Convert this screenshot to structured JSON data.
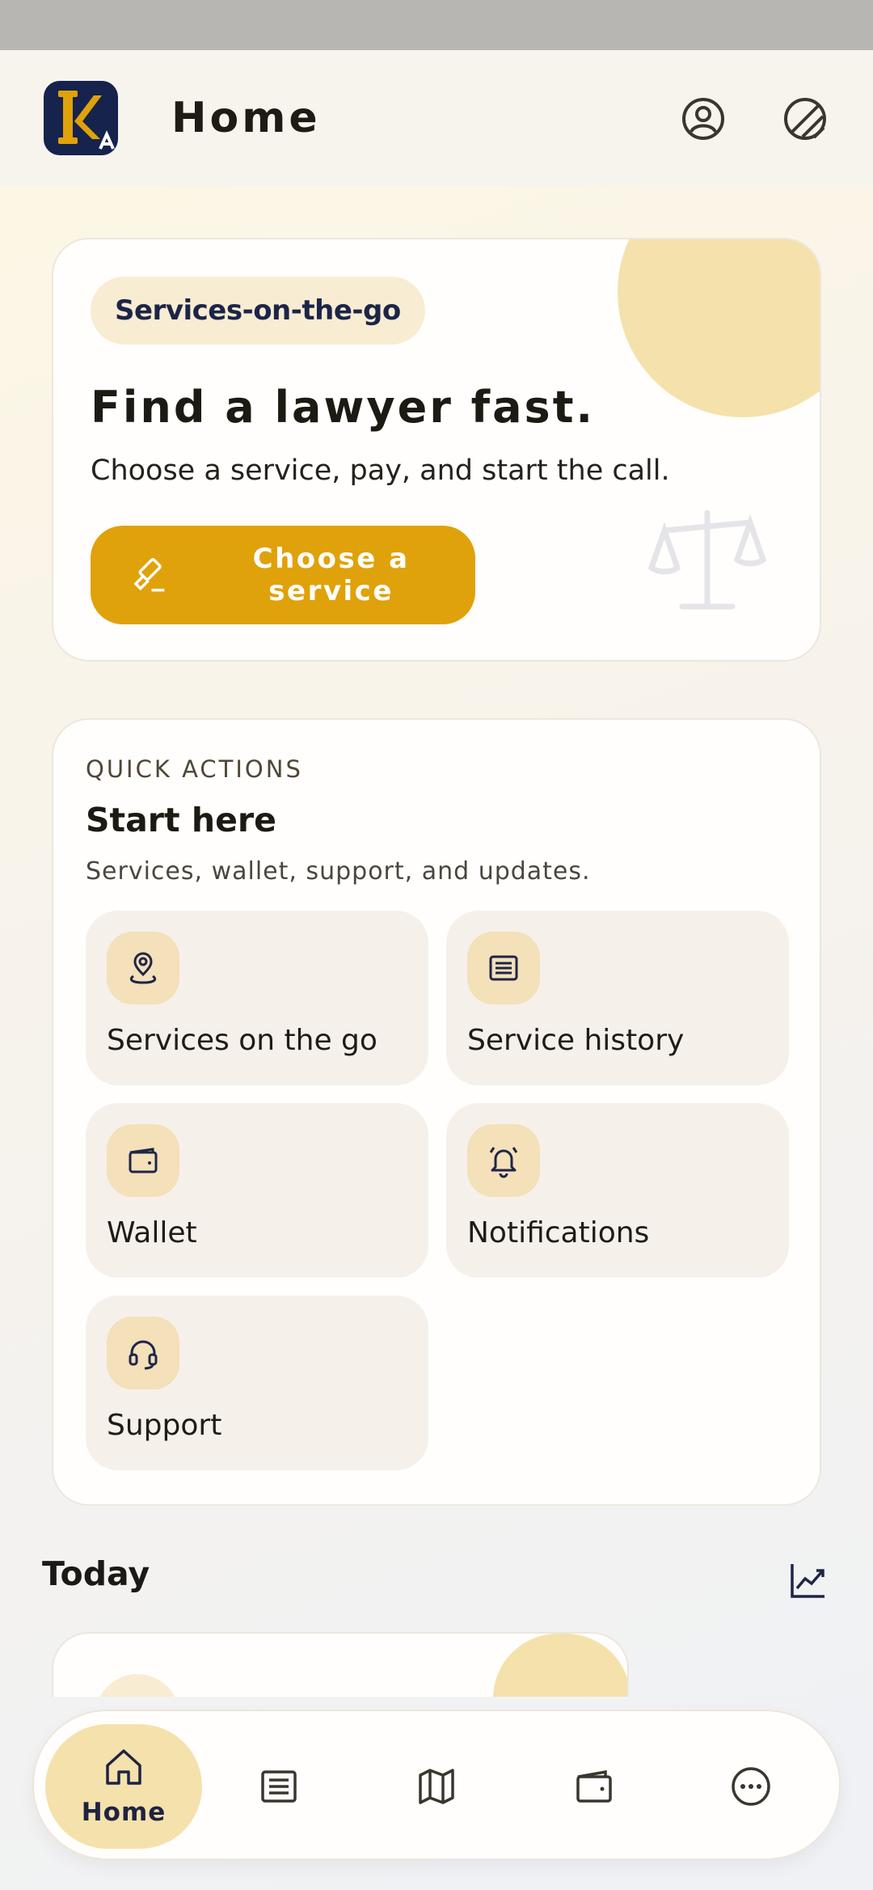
{
  "header": {
    "logo_letters": "KA",
    "title": "Home",
    "icons": [
      "profile-icon",
      "theme-toggle-icon"
    ]
  },
  "hero": {
    "chip": "Services-on-the-go",
    "title": "Find a lawyer fast.",
    "subtitle": "Choose a service, pay, and start the call.",
    "cta_label": "Choose a service",
    "cta_icon": "gavel-icon",
    "decor_icon": "scale-icon"
  },
  "quick_actions": {
    "eyebrow": "QUICK ACTIONS",
    "title": "Start here",
    "subtitle": "Services, wallet, support, and updates.",
    "tiles": [
      {
        "label": "Services on the go",
        "icon": "map-pin-icon"
      },
      {
        "label": "Service history",
        "icon": "document-icon"
      },
      {
        "label": "Wallet",
        "icon": "wallet-icon"
      },
      {
        "label": "Notifications",
        "icon": "bell-icon"
      },
      {
        "label": "Support",
        "icon": "headset-icon"
      }
    ]
  },
  "today": {
    "title": "Today",
    "icon": "trend-chart-icon"
  },
  "bottom_nav": {
    "items": [
      {
        "label": "Home",
        "icon": "home-icon",
        "active": true
      },
      {
        "icon": "document-icon"
      },
      {
        "icon": "map-icon"
      },
      {
        "icon": "wallet-icon"
      },
      {
        "icon": "more-icon"
      }
    ]
  },
  "colors": {
    "accent": "#e0a20a",
    "accent_soft": "#f5e1ab",
    "navy": "#15234d",
    "ink": "#1b1a17"
  }
}
